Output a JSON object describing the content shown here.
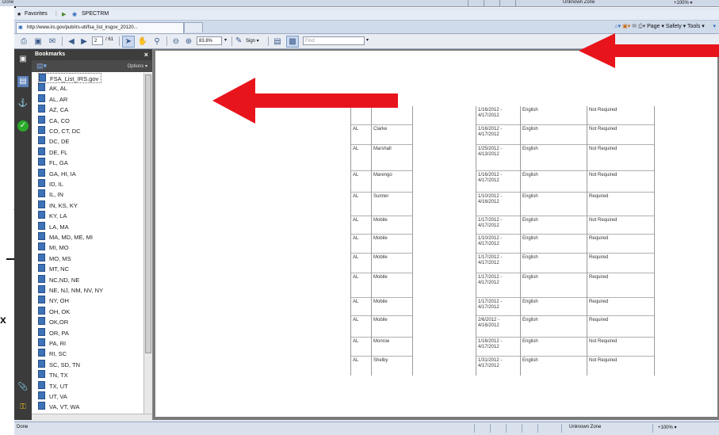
{
  "bg_window": {
    "status": "Done",
    "zone": "Unknown Zone",
    "zoom": "+100% ▾"
  },
  "cut_text": {
    "x_char": "x",
    "dash": "-"
  },
  "favorites_bar": {
    "favorites_label": "Favorites",
    "link_label": "SPECTRM"
  },
  "tab": {
    "url": "http://www.irs.gov/pub/irs-utl/fsa_list_irsgov_20120..."
  },
  "command_bar": {
    "page": "Page ▾",
    "safety": "Safety ▾",
    "tools": "Tools ▾"
  },
  "pdf_toolbar": {
    "page_number": "2",
    "page_total": "/ 61",
    "zoom": "83.8%",
    "sign": "Sign ▾",
    "find_placeholder": "Find"
  },
  "bookmarks": {
    "title": "Bookmarks",
    "close": "×",
    "options": "Options ▾",
    "items": [
      "FSA_List_IRS.gov",
      "AK, AL",
      "AL, AR",
      "AZ, CA",
      "CA, CO",
      "CO, CT, DC",
      "DC, DE",
      "DE, FL",
      "FL, GA",
      "GA, HI, IA",
      "ID, IL",
      "IL, IN",
      "IN, KS, KY",
      "KY, LA",
      "LA, MA",
      "MA, MD, ME, MI",
      "MI, MO",
      "MO, MS",
      "MT, NC",
      "NC,ND, NE",
      "NE, NJ, NM, NV, NY",
      "NY, OH",
      "OH, OK",
      "OK,OR",
      "OR, PA",
      "PA, RI",
      "RI, SC",
      "SC, SD, TN",
      "TN, TX",
      "TX, UT",
      "UT, VA",
      "VA, VT, WA"
    ]
  },
  "table": {
    "rows": [
      {
        "state": "",
        "county": "",
        "dates": "1/16/2012 -\n4/17/2012",
        "language": "English",
        "status": "Not Required"
      },
      {
        "state": "AL",
        "county": "Clarke",
        "dates": "1/16/2012 -\n4/17/2012",
        "language": "English",
        "status": "Not Required"
      },
      {
        "state": "AL",
        "county": "Marshall",
        "dates": "1/25/2012 -\n4/13/2012",
        "language": "English",
        "status": "Not Required"
      },
      {
        "state": "AL",
        "county": "Marengo",
        "dates": "1/16/2012 -\n4/17/2012",
        "language": "English",
        "status": "Not Required"
      },
      {
        "state": "AL",
        "county": "Sumter",
        "dates": "1/10/2012 -\n4/16/2012",
        "language": "English",
        "status": "Required"
      },
      {
        "state": "AL",
        "county": "Mobile",
        "dates": "1/17/2012 -\n4/17/2012",
        "language": "English",
        "status": "Not Required"
      },
      {
        "state": "AL",
        "county": "Mobile",
        "dates": "1/10/2012 -\n4/17/2012",
        "language": "English",
        "status": "Required"
      },
      {
        "state": "AL",
        "county": "Mobile",
        "dates": "1/17/2012 -\n4/17/2012",
        "language": "English",
        "status": "Required"
      },
      {
        "state": "AL",
        "county": "Mobile",
        "dates": "1/17/2012 -\n4/17/2012",
        "language": "English",
        "status": "Required"
      },
      {
        "state": "AL",
        "county": "Mobile",
        "dates": "1/17/2012 -\n4/17/2012",
        "language": "English",
        "status": "Required"
      },
      {
        "state": "AL",
        "county": "Mobile",
        "dates": "2/6/2012 -\n4/16/2012",
        "language": "English",
        "status": "Required"
      },
      {
        "state": "AL",
        "county": "Monroe",
        "dates": "1/16/2012 -\n4/17/2012",
        "language": "English",
        "status": "Not Required"
      },
      {
        "state": "AL",
        "county": "Shelby",
        "dates": "1/31/2012 -\n4/17/2012",
        "language": "English",
        "status": "Not Required"
      }
    ]
  },
  "status_bar": {
    "done": "Done",
    "zone": "Unknown Zone",
    "zoom": "+100% ▾"
  },
  "colors": {
    "arrow": "#e8141c",
    "nav_panel": "#3b3b3b"
  }
}
